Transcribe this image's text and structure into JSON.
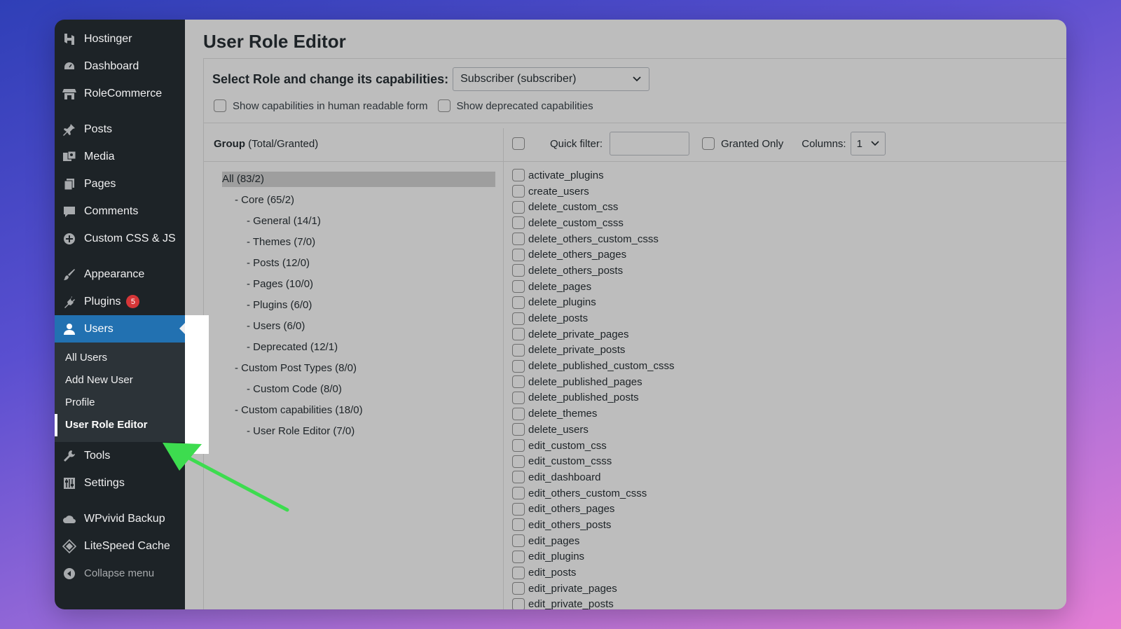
{
  "sidebar": {
    "items": [
      {
        "label": "Hostinger",
        "icon": "hostinger-icon"
      },
      {
        "label": "Dashboard",
        "icon": "dashboard-icon"
      },
      {
        "label": "RoleCommerce",
        "icon": "store-icon"
      },
      {
        "label": "Posts",
        "icon": "pin-icon"
      },
      {
        "label": "Media",
        "icon": "media-icon"
      },
      {
        "label": "Pages",
        "icon": "pages-icon"
      },
      {
        "label": "Comments",
        "icon": "comment-icon"
      },
      {
        "label": "Custom CSS & JS",
        "icon": "plus-circle-icon"
      },
      {
        "label": "Appearance",
        "icon": "brush-icon"
      },
      {
        "label": "Plugins",
        "icon": "plug-icon",
        "badge": "5"
      },
      {
        "label": "Users",
        "icon": "user-icon"
      },
      {
        "label": "Tools",
        "icon": "wrench-icon"
      },
      {
        "label": "Settings",
        "icon": "settings-icon"
      },
      {
        "label": "WPvivid Backup",
        "icon": "cloud-icon"
      },
      {
        "label": "LiteSpeed Cache",
        "icon": "diamond-icon"
      },
      {
        "label": "Collapse menu",
        "icon": "collapse-icon"
      }
    ],
    "users_submenu": [
      "All Users",
      "Add New User",
      "Profile",
      "User Role Editor"
    ]
  },
  "main": {
    "title": "User Role Editor",
    "role_label": "Select Role and change its capabilities:",
    "role_selected": "Subscriber (subscriber)",
    "opt_human_readable": "Show capabilities in human readable form",
    "opt_deprecated": "Show deprecated capabilities",
    "group_header_bold": "Group",
    "group_header_rest": "(Total/Granted)",
    "quick_filter_label": "Quick filter:",
    "granted_only_label": "Granted Only",
    "columns_label": "Columns:",
    "columns_value": "1",
    "groups": [
      {
        "label": "All (83/2)",
        "level": 0
      },
      {
        "label": "- Core (65/2)",
        "level": 1
      },
      {
        "label": "- General (14/1)",
        "level": 2
      },
      {
        "label": "- Themes (7/0)",
        "level": 2
      },
      {
        "label": "- Posts (12/0)",
        "level": 2
      },
      {
        "label": "- Pages (10/0)",
        "level": 2
      },
      {
        "label": "- Plugins (6/0)",
        "level": 2
      },
      {
        "label": "- Users (6/0)",
        "level": 2
      },
      {
        "label": "- Deprecated (12/1)",
        "level": 2
      },
      {
        "label": "- Custom Post Types (8/0)",
        "level": 1
      },
      {
        "label": "- Custom Code (8/0)",
        "level": 2
      },
      {
        "label": "- Custom capabilities (18/0)",
        "level": 1
      },
      {
        "label": "- User Role Editor (7/0)",
        "level": 2
      }
    ],
    "capabilities": [
      "activate_plugins",
      "create_users",
      "delete_custom_css",
      "delete_custom_csss",
      "delete_others_custom_csss",
      "delete_others_pages",
      "delete_others_posts",
      "delete_pages",
      "delete_plugins",
      "delete_posts",
      "delete_private_pages",
      "delete_private_posts",
      "delete_published_custom_csss",
      "delete_published_pages",
      "delete_published_posts",
      "delete_themes",
      "delete_users",
      "edit_custom_css",
      "edit_custom_csss",
      "edit_dashboard",
      "edit_others_custom_csss",
      "edit_others_pages",
      "edit_others_posts",
      "edit_pages",
      "edit_plugins",
      "edit_posts",
      "edit_private_pages",
      "edit_private_posts"
    ]
  },
  "colors": {
    "sidebar_bg": "#1d2327",
    "active_blue": "#2271b1",
    "badge_red": "#d63638",
    "arrow_green": "#3ddc4f"
  }
}
